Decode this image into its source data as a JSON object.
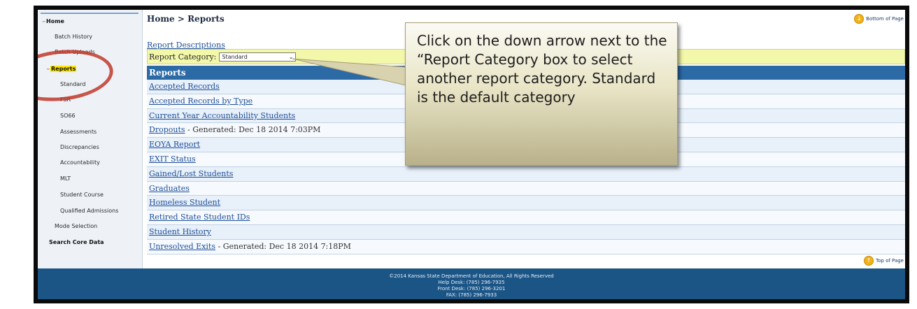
{
  "breadcrumb": "Home > Reports",
  "page_links": {
    "bottom": "Bottom of Page",
    "top": "Top of Page"
  },
  "sidebar": {
    "items": [
      {
        "label": "Home"
      },
      {
        "label": "Batch History"
      },
      {
        "label": "Batch Uploads"
      },
      {
        "label": "Reports"
      },
      {
        "label": "Standard"
      },
      {
        "label": "FSR"
      },
      {
        "label": "SO66"
      },
      {
        "label": "Assessments"
      },
      {
        "label": "Discrepancies"
      },
      {
        "label": "Accountability"
      },
      {
        "label": "MLT"
      },
      {
        "label": "Student Course"
      },
      {
        "label": "Qualified Admissions"
      },
      {
        "label": "Mode Selection"
      },
      {
        "label": "Search Core Data"
      }
    ]
  },
  "report_descriptions": "Report Descriptions",
  "category": {
    "label": "Report Category:",
    "value": "Standard"
  },
  "table": {
    "header": "Reports",
    "rows": [
      {
        "name": "Accepted Records",
        "note": ""
      },
      {
        "name": "Accepted Records by Type",
        "note": ""
      },
      {
        "name": "Current Year Accountability Students",
        "note": ""
      },
      {
        "name": "Dropouts",
        "note": " - Generated: Dec 18 2014 7:03PM"
      },
      {
        "name": "EOYA Report",
        "note": ""
      },
      {
        "name": "EXIT Status",
        "note": ""
      },
      {
        "name": "Gained/Lost Students",
        "note": ""
      },
      {
        "name": "Graduates",
        "note": ""
      },
      {
        "name": "Homeless Student",
        "note": ""
      },
      {
        "name": "Retired State Student IDs",
        "note": ""
      },
      {
        "name": "Student History",
        "note": ""
      },
      {
        "name": "Unresolved Exits",
        "note": " - Generated: Dec 18 2014 7:18PM"
      }
    ]
  },
  "footer": {
    "lines": [
      "©2014 Kansas State Department of Education, All Rights Reserved",
      "Help Desk: (785) 296-7935",
      "Front Desk: (785) 296-3201",
      "FAX: (785) 296-7933"
    ]
  },
  "callout": {
    "text": "Click on the down arrow next to the “Report Category box to select another report category. Standard is the default category"
  },
  "colors": {
    "header": "#2c6aa6",
    "footer": "#1b5586",
    "category_bar": "#f2f7a9",
    "highlight": "#ffe600",
    "annotation_circle": "#c0392b"
  }
}
